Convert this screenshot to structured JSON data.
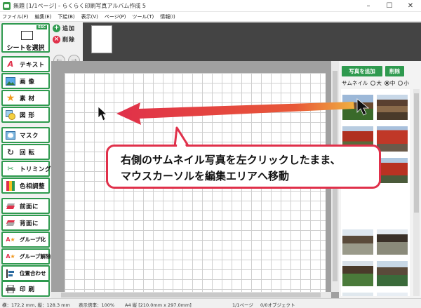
{
  "window": {
    "title": "無題 [1/1ページ] - らくらく印刷写真アルバム作成 5"
  },
  "menu": [
    "ファイル(F)",
    "編集(E)",
    "下絵(B)",
    "表示(V)",
    "ページ(P)",
    "ツール(T)",
    "情報(I)"
  ],
  "tools": {
    "select": {
      "label": "シートを選択",
      "badge": "ESC"
    },
    "items": [
      {
        "label": "テキスト",
        "icon": "text-icon"
      },
      {
        "label": "画 像",
        "icon": "image-icon"
      },
      {
        "label": "素 材",
        "icon": "star-icon"
      },
      {
        "label": "図 形",
        "icon": "shape-icon"
      },
      {
        "label": "マスク",
        "icon": "mask-icon"
      },
      {
        "label": "回 転",
        "icon": "rotate-icon"
      },
      {
        "label": "トリミング",
        "icon": "trim-icon"
      },
      {
        "label": "色相調整",
        "icon": "color-icon"
      },
      {
        "label": "前面に",
        "icon": "front-icon"
      },
      {
        "label": "背面に",
        "icon": "back-icon"
      },
      {
        "label": "グループ化",
        "icon": "group-icon"
      },
      {
        "label": "グループ解除",
        "icon": "ungroup-icon"
      },
      {
        "label": "位置合わせ",
        "icon": "align-icon"
      },
      {
        "label": "印 刷",
        "icon": "printer-icon"
      }
    ]
  },
  "pages": {
    "add_label": "追加",
    "delete_label": "削除"
  },
  "photos_panel": {
    "add_label": "写真を追加",
    "delete_label": "削除",
    "thumb_size_label": "サムネイル",
    "sizes": [
      "大",
      "中",
      "小"
    ],
    "selected_size": "中"
  },
  "status": {
    "coords": "横：172.2 mm, 縦：128.3 mm",
    "zoom": "表示倍率：100%",
    "paper": "A4 縦 [210.0mm x 297.0mm]",
    "page": "1/1ページ",
    "objects": "0/0オブジェクト"
  },
  "callout": {
    "line1": "右側のサムネイル写真を左クリックしたまま、",
    "line2": "マウスカーソルを編集エリアへ移動"
  },
  "colors": {
    "accent": "#2f9a4f",
    "callout_border": "#e0304a",
    "arrow_start": "#e0304a",
    "arrow_end": "#f0b040"
  }
}
